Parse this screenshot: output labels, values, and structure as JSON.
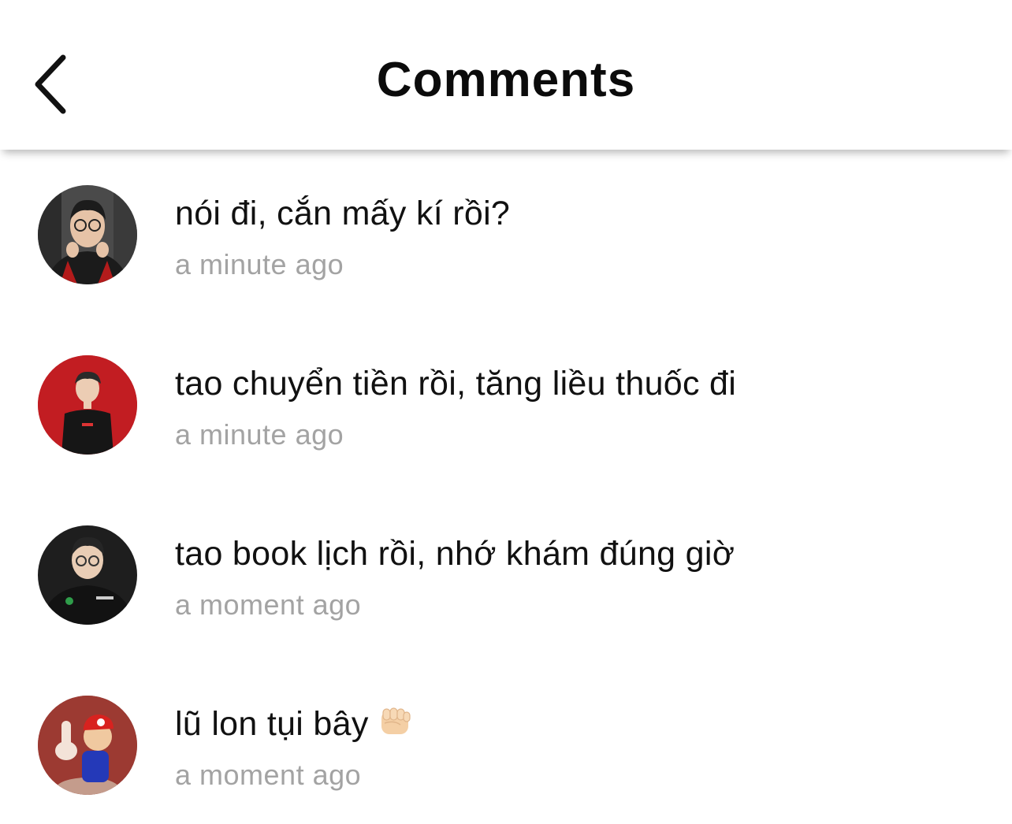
{
  "header": {
    "title": "Comments",
    "back_icon": "chevron-left-icon"
  },
  "comments": [
    {
      "text": "nói đi, cắn mấy kí rồi?",
      "time": "a minute ago",
      "avatar_icon": "user-avatar-icon"
    },
    {
      "text": "tao chuyển tiền rồi, tăng liều thuốc đi",
      "time": "a minute ago",
      "avatar_icon": "user-avatar-icon"
    },
    {
      "text": "tao book lịch rồi, nhớ khám đúng giờ",
      "time": "a moment ago",
      "avatar_icon": "user-avatar-icon"
    },
    {
      "text": "lũ lon tụi bây",
      "time": "a moment ago",
      "avatar_icon": "user-avatar-icon",
      "emoji": "fist-emoji-icon"
    }
  ],
  "colors": {
    "text": "#111111",
    "timestamp": "#a3a3a3",
    "background": "#ffffff"
  }
}
